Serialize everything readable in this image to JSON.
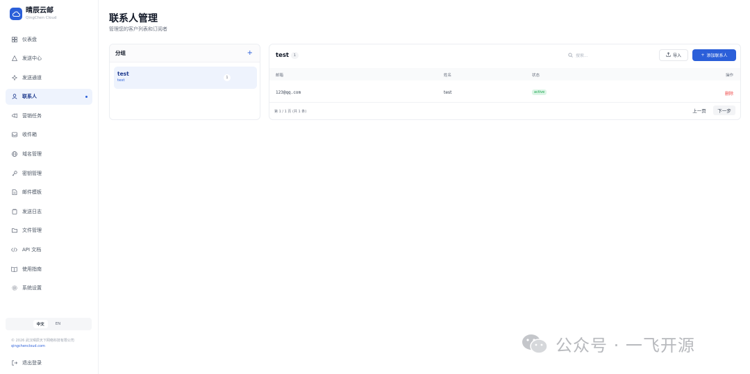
{
  "brand": {
    "name": "晴辰云邮",
    "sub": "QingChen Cloud",
    "accent": "#2b5fd9"
  },
  "nav": [
    {
      "label": "仪表盘",
      "icon": "grid-icon",
      "key": "dashboard"
    },
    {
      "label": "发送中心",
      "icon": "send-icon",
      "key": "send-center"
    },
    {
      "label": "发送通道",
      "icon": "channel-icon",
      "key": "send-channel"
    },
    {
      "label": "联系人",
      "icon": "contacts-icon",
      "key": "contacts",
      "active": true
    },
    {
      "label": "营销任务",
      "icon": "megaphone-icon",
      "key": "campaigns"
    },
    {
      "label": "收件箱",
      "icon": "inbox-icon",
      "key": "inbox"
    },
    {
      "label": "域名管理",
      "icon": "globe-icon",
      "key": "domains"
    },
    {
      "label": "密钥管理",
      "icon": "key-icon",
      "key": "keys"
    },
    {
      "label": "邮件模板",
      "icon": "template-icon",
      "key": "templates"
    },
    {
      "label": "发送日志",
      "icon": "log-icon",
      "key": "logs"
    },
    {
      "label": "文件管理",
      "icon": "folder-icon",
      "key": "files"
    },
    {
      "label": "API 文档",
      "icon": "code-icon",
      "key": "api-docs"
    },
    {
      "label": "使用指南",
      "icon": "book-icon",
      "key": "guide"
    },
    {
      "label": "系统设置",
      "icon": "gear-icon",
      "key": "settings"
    }
  ],
  "lang": {
    "zh": "中文",
    "en": "EN"
  },
  "footer": {
    "copyright": "© 2026 武汉晴辰天下网络科技有限公司",
    "site": "qingchencloud.com",
    "logout": "退出登录"
  },
  "header": {
    "title": "联系人管理",
    "subtitle": "管理您的客户列表和订阅者"
  },
  "groups": {
    "title": "分组",
    "add": "+",
    "items": [
      {
        "name": "test",
        "desc": "test",
        "count": "1"
      }
    ]
  },
  "contacts": {
    "title": "test",
    "count": "1",
    "search_placeholder": "搜索...",
    "import_label": "导入",
    "add_label": "添加联系人",
    "columns": [
      "邮箱",
      "姓名",
      "状态",
      "操作"
    ],
    "rows": [
      {
        "email": "123@qq.com",
        "name": "test",
        "status": "active",
        "action": "删除"
      }
    ],
    "pager": {
      "info": "第 1 / 1 页 (共 1 条)",
      "prev": "上一页",
      "next": "下一步"
    }
  },
  "watermark": "公众号 · 一飞开源"
}
